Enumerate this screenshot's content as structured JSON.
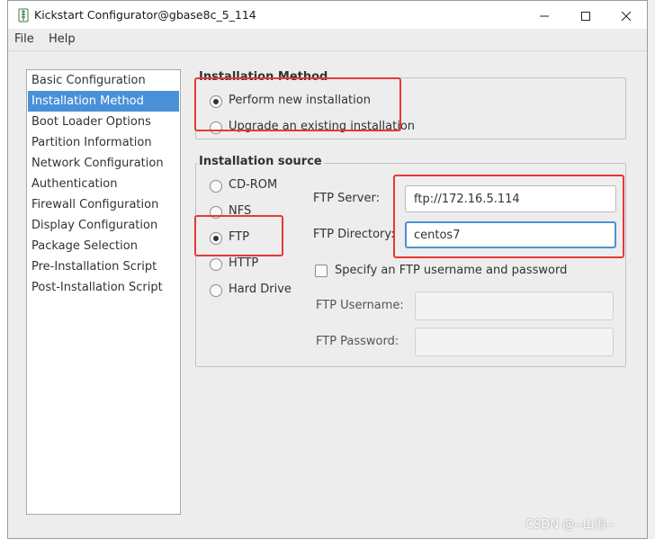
{
  "window": {
    "title": "Kickstart Configurator@gbase8c_5_114",
    "controls": {
      "minimize": "—",
      "maximize": "☐",
      "close": "✕"
    }
  },
  "menu": [
    {
      "label": "File"
    },
    {
      "label": "Help"
    }
  ],
  "sidebar": {
    "selected": "Installation Method",
    "items": [
      {
        "label": "Basic Configuration"
      },
      {
        "label": "Installation Method"
      },
      {
        "label": "Boot Loader Options"
      },
      {
        "label": "Partition Information"
      },
      {
        "label": "Network Configuration"
      },
      {
        "label": "Authentication"
      },
      {
        "label": "Firewall Configuration"
      },
      {
        "label": "Display Configuration"
      },
      {
        "label": "Package Selection"
      },
      {
        "label": "Pre-Installation Script"
      },
      {
        "label": "Post-Installation Script"
      }
    ]
  },
  "installation_method": {
    "title": "Installation Method",
    "options": [
      {
        "label": "Perform new installation",
        "selected": true
      },
      {
        "label": "Upgrade an existing installation",
        "selected": false
      }
    ]
  },
  "installation_source": {
    "title": "Installation source",
    "options": [
      {
        "label": "CD-ROM",
        "selected": false
      },
      {
        "label": "NFS",
        "selected": false
      },
      {
        "label": "FTP",
        "selected": true
      },
      {
        "label": "HTTP",
        "selected": false
      },
      {
        "label": "Hard Drive",
        "selected": false
      }
    ],
    "ftp_server": {
      "label": "FTP Server:",
      "value": "ftp://172.16.5.114"
    },
    "ftp_directory": {
      "label": "FTP Directory:",
      "value": "centos7"
    },
    "specify_credentials": {
      "label": "Specify an FTP username and password",
      "checked": false
    },
    "ftp_username": {
      "label": "FTP Username:",
      "value": ""
    },
    "ftp_password": {
      "label": "FTP Password:",
      "value": ""
    }
  },
  "watermark": "CSDN @--山海--",
  "colors": {
    "selection": "#4a90d9",
    "highlight_box": "#e53935"
  }
}
